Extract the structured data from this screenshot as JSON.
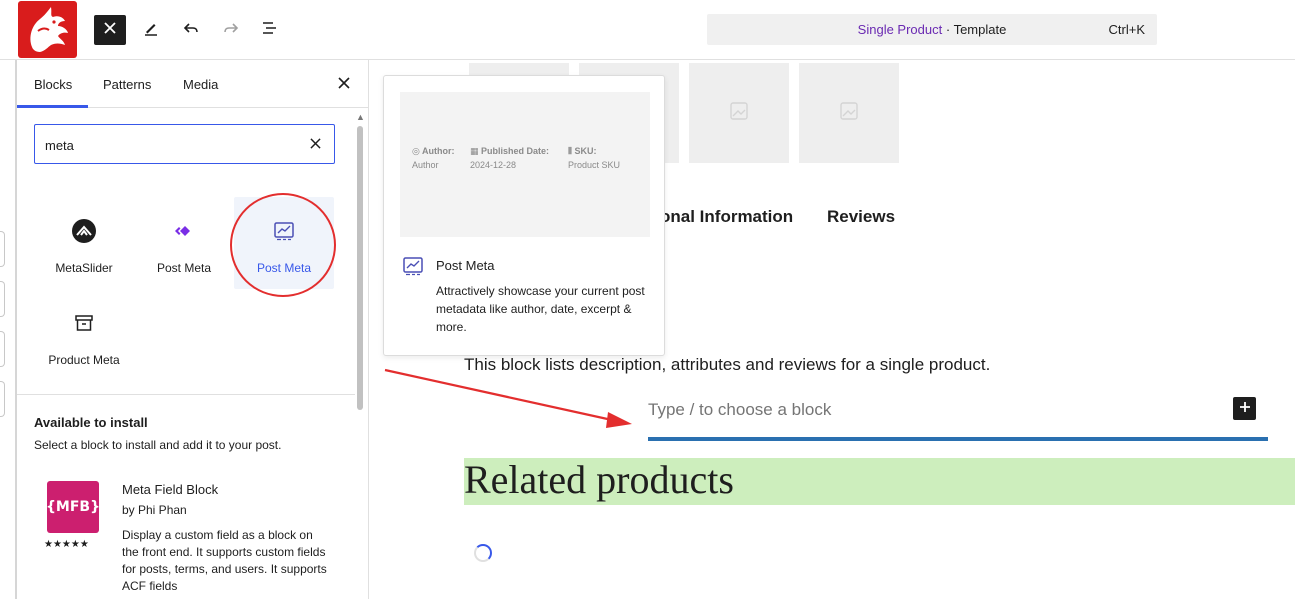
{
  "colors": {
    "accent": "#3858e9",
    "annotation": "#e32e2e",
    "related_bg": "#cdeebd",
    "template_type": "#6a2ab2",
    "mfb_brand": "#cc1f6f"
  },
  "toolbar": {
    "close_icon": "close-icon",
    "tools_icon": "pencil-icon",
    "undo_icon": "undo-icon",
    "redo_icon": "redo-icon",
    "list_view_icon": "list-view-icon"
  },
  "command_bar": {
    "type": "Single Product",
    "separator": " · ",
    "label": "Template",
    "shortcut": "Ctrl+K"
  },
  "inserter": {
    "tabs": [
      {
        "label": "Blocks"
      },
      {
        "label": "Patterns"
      },
      {
        "label": "Media"
      }
    ],
    "search": {
      "value": "meta"
    },
    "results": [
      {
        "label": "MetaSlider",
        "icon": "metaslider-icon"
      },
      {
        "label": "Post Meta",
        "icon": "post-meta-diamond-icon"
      },
      {
        "label": "Post Meta",
        "icon": "post-meta-chart-icon"
      },
      {
        "label": "Product Meta",
        "icon": "archive-box-icon"
      }
    ],
    "install": {
      "title": "Available to install",
      "subtitle": "Select a block to install and add it to your post.",
      "plugins": [
        {
          "badge": "{MFB}",
          "rating": 5,
          "stars": "★★★★★",
          "name": "Meta Field Block",
          "author": "by Phi Phan",
          "description": "Display a custom field as a block on the front end. It supports custom fields for posts, terms, and users. It supports ACF fields"
        }
      ]
    }
  },
  "preview": {
    "meta": [
      {
        "label": "Author:",
        "value": "Author"
      },
      {
        "label": "Published Date:",
        "value": "2024-12-28"
      },
      {
        "label": "SKU:",
        "value": "Product SKU"
      }
    ],
    "title": "Post Meta",
    "description": "Attractively showcase your current post metadata like author, date, excerpt & more."
  },
  "canvas": {
    "product_tabs": [
      {
        "label": "onal Information"
      },
      {
        "label": "Reviews"
      }
    ],
    "block_description": "This block lists description, attributes and reviews for a single product.",
    "appender_placeholder": "Type / to choose a block",
    "related_heading": "Related products"
  }
}
